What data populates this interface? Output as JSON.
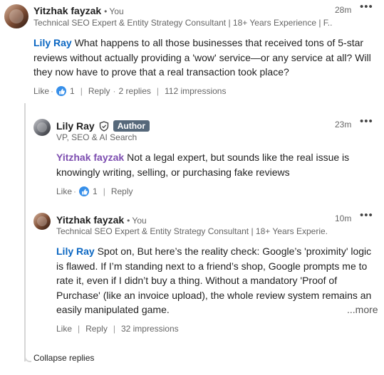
{
  "comment_main": {
    "author": "Yitzhak fayzak",
    "you_label": "• You",
    "headline": "Technical SEO Expert & Entity Strategy Consultant | 18+ Years Experience | F...",
    "time": "28m",
    "mention": "Lily Ray",
    "text": " What happens to all those businesses that received tons of 5-star reviews without actually providing a 'wow' service—or any service at all? Will they now have to prove that a real transaction took place?",
    "like_label": "Like",
    "reaction_count": "1",
    "reply_label": "Reply",
    "replies_count": "2 replies",
    "impressions": "112 impressions"
  },
  "reply_1": {
    "author": "Lily Ray",
    "author_badge": "Author",
    "headline": "VP, SEO & AI Search",
    "time": "23m",
    "mention": "Yitzhak fayzak",
    "text": " Not a legal expert, but sounds like the real issue is knowingly writing, selling, or purchasing fake reviews",
    "like_label": "Like",
    "reaction_count": "1",
    "reply_label": "Reply"
  },
  "reply_2": {
    "author": "Yitzhak fayzak",
    "you_label": "• You",
    "headline": "Technical SEO Expert & Entity Strategy Consultant | 18+ Years Experie...",
    "time": "10m",
    "mention": "Lily Ray",
    "text": " Spot on, But here’s the reality check: Google’s 'proximity' logic is flawed. If I’m standing next to a friend’s shop, Google prompts me to rate it, even if I didn’t buy a thing. Without a mandatory 'Proof of Purchase' (like an invoice upload), the whole review system remains an easily manipulated game.",
    "see_more": "...more",
    "like_label": "Like",
    "reply_label": "Reply",
    "impressions": "32 impressions"
  },
  "collapse_label": "Collapse replies",
  "colors": {
    "link_blue": "#0a66c2",
    "mention_purple": "#7d4eb0",
    "like_blue": "#378fe9",
    "badge_gray": "#56687a"
  },
  "icons": {
    "more": "more-options-icon",
    "like": "thumbs-up-icon",
    "verified": "verified-shield-icon"
  }
}
